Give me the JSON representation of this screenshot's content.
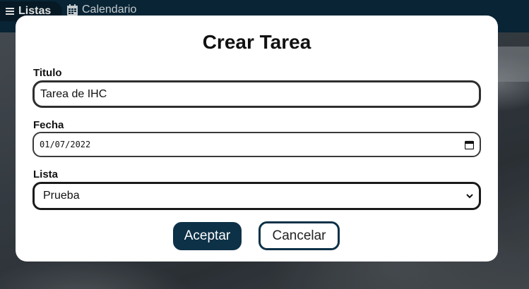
{
  "nav": {
    "listas_label": "Listas",
    "calendario_label": "Calendario"
  },
  "modal": {
    "title": "Crear Tarea",
    "titulo": {
      "label": "Titulo",
      "value": "Tarea de IHC"
    },
    "fecha": {
      "label": "Fecha",
      "value": "01/07/2022"
    },
    "lista": {
      "label": "Lista",
      "selected": "Prueba"
    },
    "accept_label": "Aceptar",
    "cancel_label": "Cancelar"
  },
  "icons": {
    "menu": "hamburger-icon",
    "calendar": "calendar-icon",
    "date_picker": "calendar-icon",
    "select_arrow": "chevron-down-icon"
  },
  "colors": {
    "topbar": "#0a2a3d",
    "primary": "#0d3147",
    "modal_bg": "#ffffff"
  }
}
